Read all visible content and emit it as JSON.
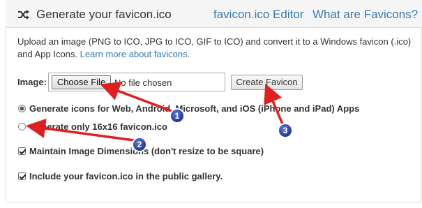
{
  "header": {
    "title": "Generate your favicon.ico",
    "links": [
      "favicon.ico Editor",
      "What are Favicons?"
    ]
  },
  "intro": {
    "text": "Upload an image (PNG to ICO, JPG to ICO, GIF to ICO) and convert it to a Windows favicon (.ico) and App Icons.",
    "link": "Learn more about favicons."
  },
  "form": {
    "image_label": "Image:",
    "choose_file_label": "Choose File",
    "no_file_text": "No file chosen",
    "create_button": "Create Favicon",
    "options": [
      {
        "type": "radio",
        "checked": true,
        "label": "Generate icons for Web, Android, Microsoft, and iOS (iPhone and iPad) Apps"
      },
      {
        "type": "radio",
        "checked": false,
        "label": "Generate only 16x16 favicon.ico"
      },
      {
        "type": "checkbox",
        "checked": true,
        "label": "Maintain Image Dimensions (don't resize to be square)"
      },
      {
        "type": "checkbox",
        "checked": true,
        "label": "Include your favicon.ico in the public gallery."
      }
    ]
  },
  "annotations": {
    "badges": [
      "1",
      "2",
      "3"
    ],
    "arrow_color": "#e02020",
    "badge_color": "#1f3fa8"
  }
}
